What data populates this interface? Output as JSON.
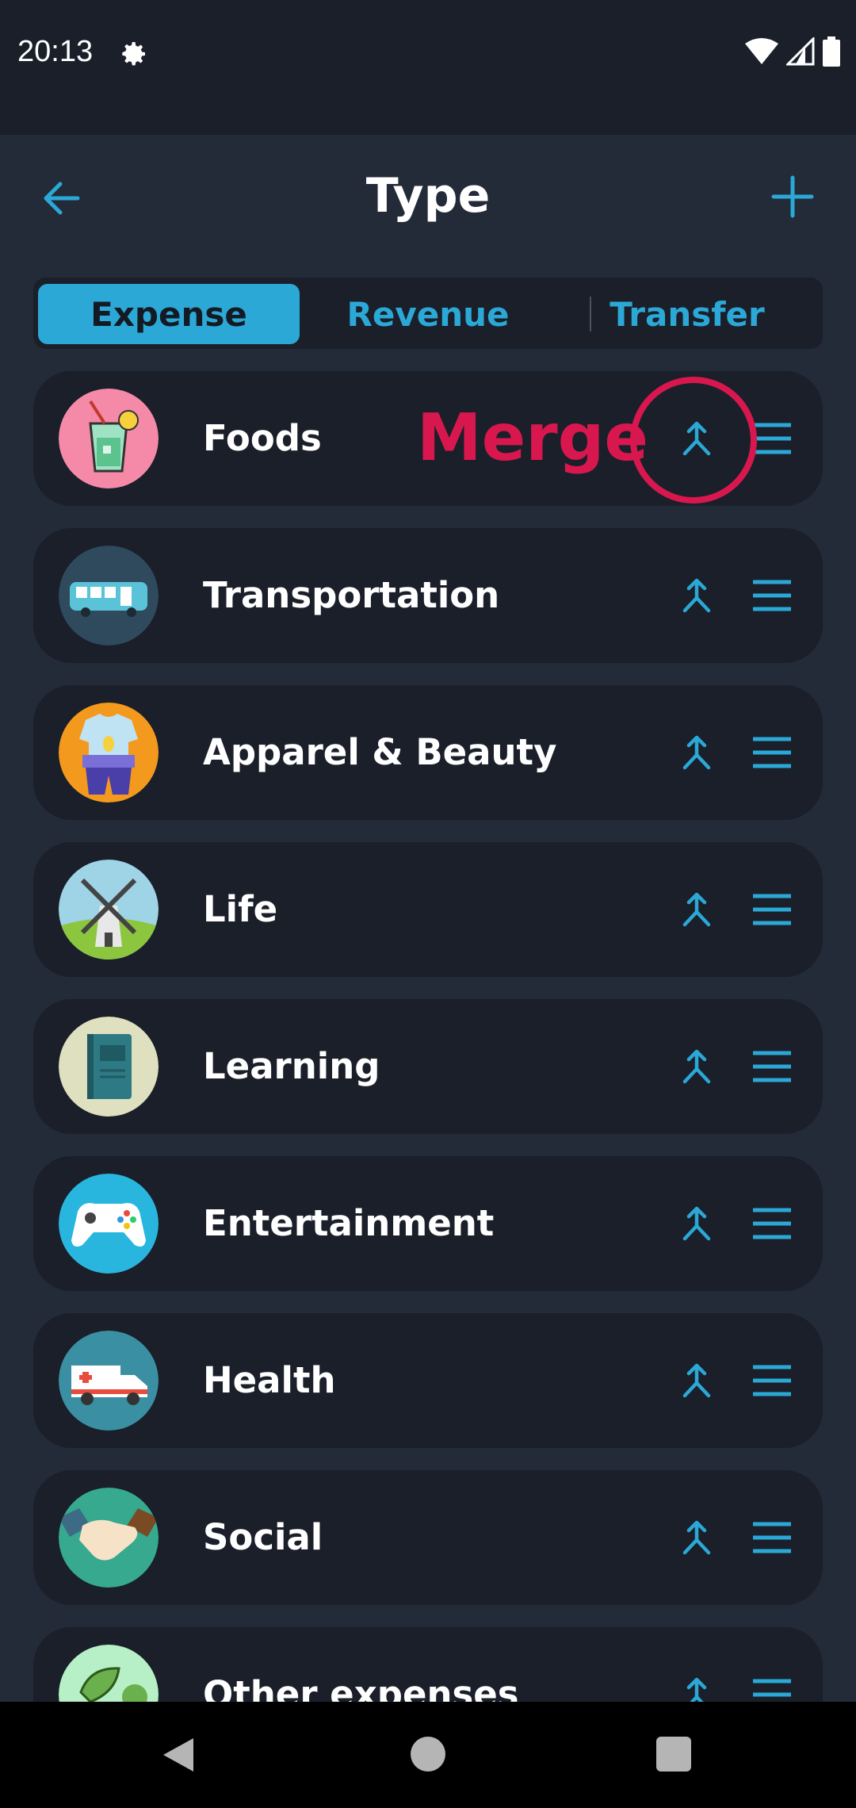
{
  "status_bar": {
    "time": "20:13"
  },
  "header": {
    "title": "Type"
  },
  "tabs": [
    {
      "label": "Expense",
      "active": true
    },
    {
      "label": "Revenue",
      "active": false
    },
    {
      "label": "Transfer",
      "active": false
    }
  ],
  "rows": [
    {
      "label": "Foods",
      "icon": "drink-icon"
    },
    {
      "label": "Transportation",
      "icon": "bus-icon"
    },
    {
      "label": "Apparel & Beauty",
      "icon": "clothes-icon"
    },
    {
      "label": "Life",
      "icon": "windmill-icon"
    },
    {
      "label": "Learning",
      "icon": "book-icon"
    },
    {
      "label": "Entertainment",
      "icon": "gamepad-icon"
    },
    {
      "label": "Health",
      "icon": "ambulance-icon"
    },
    {
      "label": "Social",
      "icon": "handshake-icon"
    },
    {
      "label": "Other expenses",
      "icon": "leaf-icon"
    }
  ],
  "annotation": {
    "label": "Merge"
  },
  "colors": {
    "accent": "#2ba8d6",
    "annotation": "#d9174f",
    "background": "#232a38",
    "card": "#1a1f2a"
  }
}
